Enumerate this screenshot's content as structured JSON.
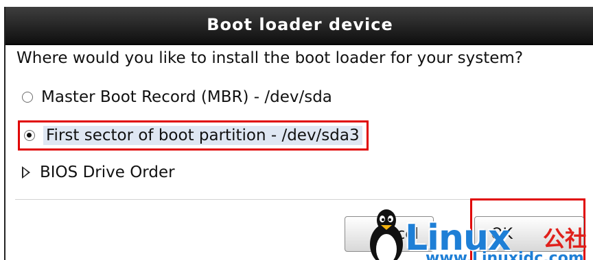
{
  "dialog": {
    "title": "Boot loader device",
    "question": "Where would you like to install the boot loader for your system?",
    "options": [
      {
        "label": "Master Boot Record (MBR) - /dev/sda",
        "selected": false
      },
      {
        "label": "First sector of boot partition - /dev/sda3",
        "selected": true
      }
    ],
    "expander_label": "BIOS Drive Order",
    "buttons": {
      "cancel_label": "ncel",
      "ok_label": "OK"
    }
  },
  "watermark": {
    "brand": "Linux",
    "brand_cn": "公社",
    "url": "www.Linuxidc.com"
  },
  "colors": {
    "titlebar": "#1a1a1a",
    "highlight_box": "#e00000",
    "selection_bg": "#dfe7f3",
    "watermark_blue": "#1e7fd6",
    "watermark_red": "#e0201b"
  }
}
